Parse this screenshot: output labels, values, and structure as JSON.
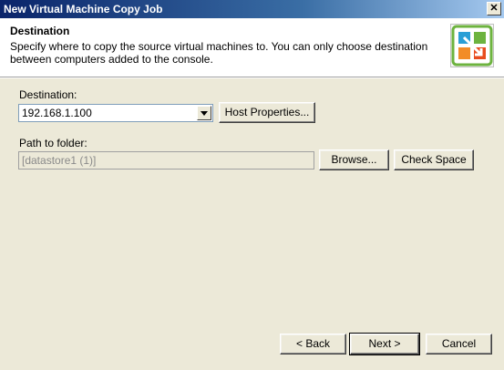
{
  "window": {
    "title": "New Virtual Machine Copy Job",
    "close_glyph": "✕"
  },
  "header": {
    "heading": "Destination",
    "description": "Specify where to copy the source virtual machines to. You can only choose destination between computers added to the console.",
    "logo_icon": "copy-job-wizard-icon"
  },
  "destination": {
    "label": "Destination:",
    "selected": "192.168.1.100",
    "host_properties_label": "Host Properties..."
  },
  "path": {
    "label": "Path to folder:",
    "value": "[datastore1 (1)]",
    "browse_label": "Browse...",
    "check_space_label": "Check Space"
  },
  "footer": {
    "back_label": "< Back",
    "next_label": "Next >",
    "cancel_label": "Cancel"
  },
  "colors": {
    "title_bar": "#0a246a",
    "dialog_bg": "#ece9d8",
    "logo_green": "#6db33f",
    "logo_orange": "#f28c28",
    "logo_blue": "#2a9fd6"
  }
}
